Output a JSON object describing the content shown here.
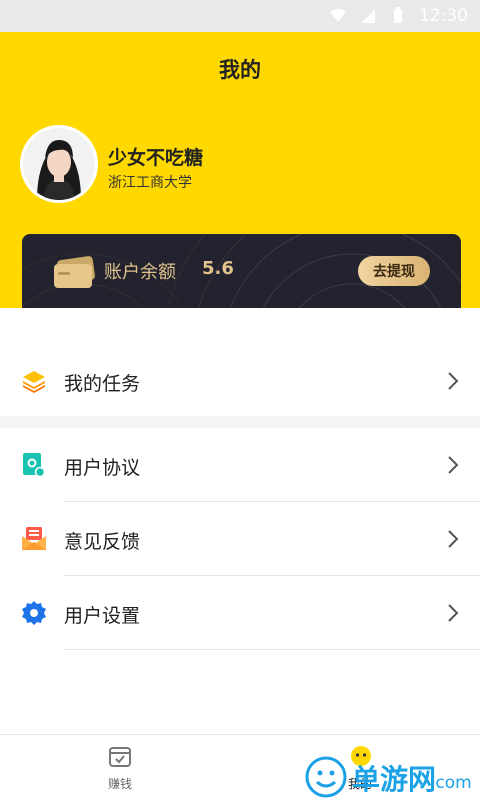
{
  "status_bar": {
    "time": "12:30"
  },
  "header": {
    "title": "我的",
    "user": {
      "name": "少女不吃糖",
      "school": "浙江工商大学"
    }
  },
  "balance": {
    "label": "账户余额",
    "value": "5.6",
    "withdraw_label": "去提现"
  },
  "menu": {
    "tasks": "我的任务",
    "agreement": "用户协议",
    "feedback": "意见反馈",
    "settings": "用户设置"
  },
  "tabs": [
    {
      "label": "赚钱",
      "icon": "earn-icon"
    },
    {
      "label": "我的",
      "icon": "mine-icon"
    }
  ],
  "watermark": {
    "text": "单游网",
    "suffix": ".com"
  },
  "colors": {
    "brand_yellow": "#FFD800",
    "card_dark": "#23232f",
    "gold": "#e0c28a",
    "watermark_blue": "#1aa1e6"
  }
}
